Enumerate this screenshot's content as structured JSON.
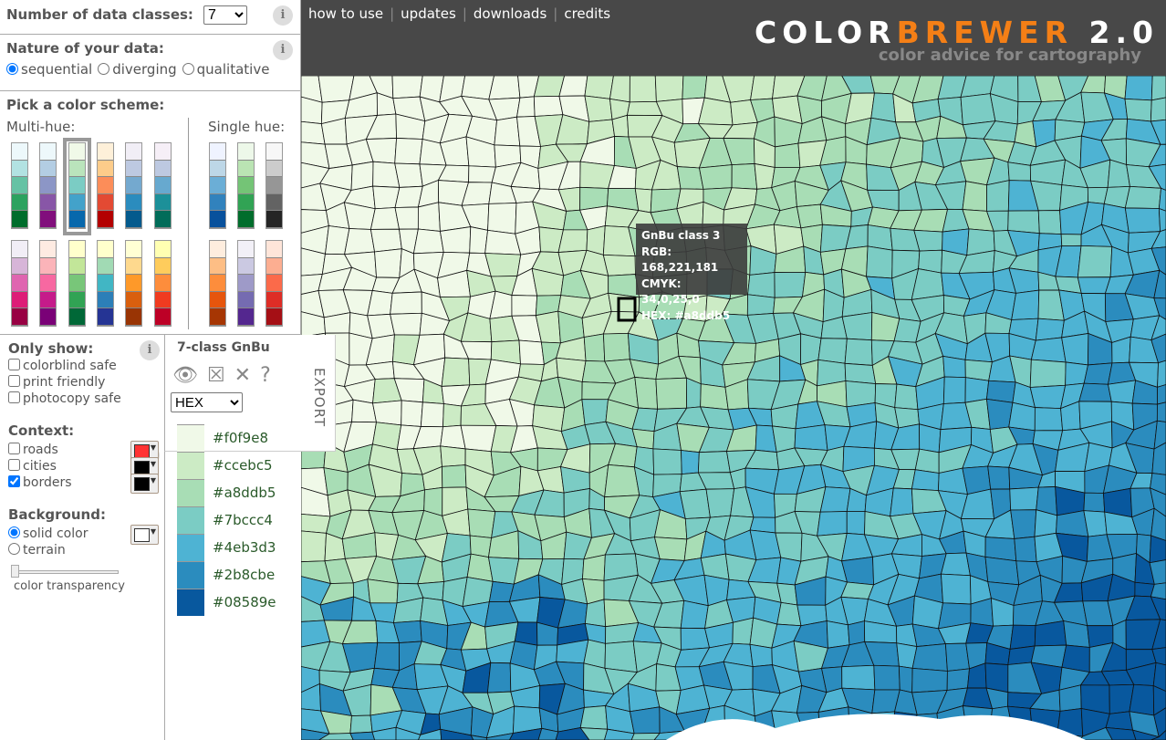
{
  "controls": {
    "classes_label": "Number of data classes:",
    "classes_value": "7",
    "nature_label": "Nature of your data:",
    "nature_options": [
      "sequential",
      "diverging",
      "qualitative"
    ],
    "nature_selected": "sequential",
    "pick_label": "Pick a color scheme:",
    "multi_label": "Multi-hue:",
    "single_label": "Single hue:"
  },
  "schemes": {
    "multi_row1": [
      [
        "#edf8fb",
        "#b2e2e2",
        "#66c2a4",
        "#2ca25f",
        "#006d2c"
      ],
      [
        "#edf8fb",
        "#b3cde3",
        "#8c96c6",
        "#8856a7",
        "#810f7c"
      ],
      [
        "#f0f9e8",
        "#bae4bc",
        "#7bccc4",
        "#43a2ca",
        "#0868ac"
      ],
      [
        "#fef0d9",
        "#fdcc8a",
        "#fc8d59",
        "#e34a33",
        "#b30000"
      ],
      [
        "#f1eef6",
        "#bdc9e1",
        "#74a9cf",
        "#2b8cbe",
        "#045a8d"
      ],
      [
        "#f6eff7",
        "#bdc9e1",
        "#67a9cf",
        "#1c9099",
        "#016c59"
      ]
    ],
    "multi_row2": [
      [
        "#f1eef6",
        "#d7b5d8",
        "#df65b0",
        "#dd1c77",
        "#980043"
      ],
      [
        "#feebe2",
        "#fbb4b9",
        "#f768a1",
        "#c51b8a",
        "#7a0177"
      ],
      [
        "#ffffcc",
        "#c2e699",
        "#78c679",
        "#31a354",
        "#006837"
      ],
      [
        "#ffffcc",
        "#a1dab4",
        "#41b6c4",
        "#2c7fb8",
        "#253494"
      ],
      [
        "#ffffd4",
        "#fed98e",
        "#fe9929",
        "#d95f0e",
        "#993404"
      ],
      [
        "#ffffb2",
        "#fecc5c",
        "#fd8d3c",
        "#f03b20",
        "#bd0026"
      ]
    ],
    "single_row1": [
      [
        "#eff3ff",
        "#bdd7e7",
        "#6baed6",
        "#3182bd",
        "#08519c"
      ],
      [
        "#edf8e9",
        "#bae4b3",
        "#74c476",
        "#31a354",
        "#006d2c"
      ],
      [
        "#f7f7f7",
        "#cccccc",
        "#969696",
        "#636363",
        "#252525"
      ]
    ],
    "single_row2": [
      [
        "#feedde",
        "#fdbe85",
        "#fd8d3c",
        "#e6550d",
        "#a63603"
      ],
      [
        "#f2f0f7",
        "#cbc9e2",
        "#9e9ac8",
        "#756bb1",
        "#54278f"
      ],
      [
        "#fee5d9",
        "#fcae91",
        "#fb6a4a",
        "#de2d26",
        "#a50f15"
      ]
    ],
    "selected": "GnBu"
  },
  "filters": {
    "label": "Only show:",
    "items": [
      {
        "label": "colorblind safe",
        "checked": false
      },
      {
        "label": "print friendly",
        "checked": false
      },
      {
        "label": "photocopy safe",
        "checked": false
      }
    ]
  },
  "context": {
    "label": "Context:",
    "items": [
      {
        "label": "roads",
        "checked": false,
        "color": "#ff3333"
      },
      {
        "label": "cities",
        "checked": false,
        "color": "#000000"
      },
      {
        "label": "borders",
        "checked": true,
        "color": "#000000"
      }
    ]
  },
  "background": {
    "label": "Background:",
    "options": [
      "solid color",
      "terrain"
    ],
    "selected": "solid color",
    "color": "#ffffff",
    "transparency_label": "color transparency",
    "transparency": 0
  },
  "export": {
    "title": "7-class GnBu",
    "format": "HEX",
    "tab_label": "EXPORT",
    "icons": [
      "eye-icon",
      "colorblind-icon",
      "print-icon",
      "photocopy-icon"
    ]
  },
  "legend": [
    {
      "hex": "#f0f9e8"
    },
    {
      "hex": "#ccebc5"
    },
    {
      "hex": "#a8ddb5"
    },
    {
      "hex": "#7bccc4"
    },
    {
      "hex": "#4eb3d3"
    },
    {
      "hex": "#2b8cbe"
    },
    {
      "hex": "#08589e"
    }
  ],
  "nav": [
    "how to use",
    "updates",
    "downloads",
    "credits"
  ],
  "brand": {
    "part1": "COLOR",
    "part2": "BREWER",
    "part3": " 2.0",
    "subtitle": "color advice for cartography",
    "accent": "#f47f16"
  },
  "tooltip": {
    "title": "GnBu class 3",
    "rgb": "RGB: 168,221,181",
    "cmyk": "CMYK: 34,0,25,0",
    "hex": "HEX: #a8ddb5"
  }
}
